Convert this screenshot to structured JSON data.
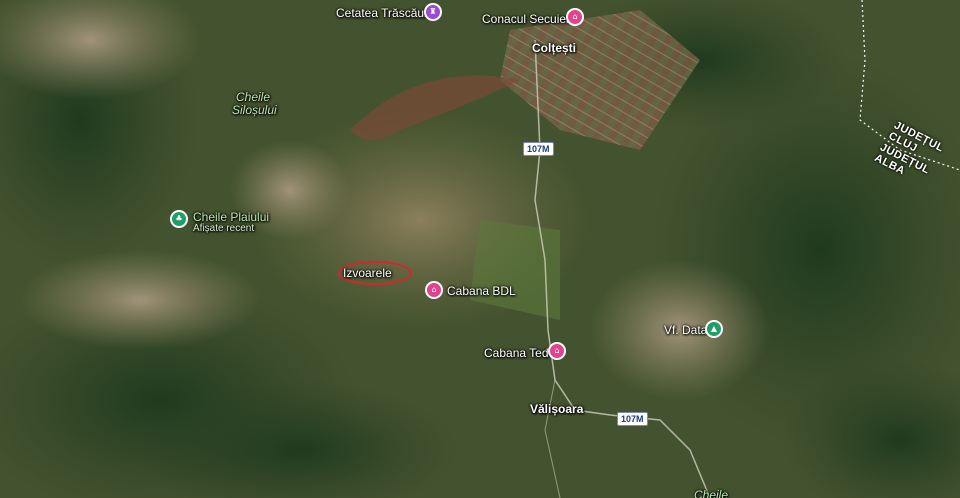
{
  "map": {
    "places": {
      "cetatea": "Cetatea Trăscăului",
      "conacul": "Conacul Secuiesc",
      "coltesti": "Colțești",
      "cheile_silosului_1": "Cheile",
      "cheile_silosului_2": "Siloșului",
      "cheile_plaiului": "Cheile Plaiului",
      "afisate_recent": "Afișate recent",
      "izvoarele": "Izvoarele",
      "cabana_bdl": "Cabana BDL",
      "cabana_teds": "Cabana Ted's",
      "vf_data": "Vf. Data",
      "valisoara": "Vălișoara",
      "cheile_bottom": "Cheile"
    },
    "roads": {
      "road_top": "107M",
      "road_bottom": "107M"
    },
    "counties": {
      "cluj": "JUDEȚUL CLUJ",
      "alba": "JUDEȚUL ALBA"
    },
    "icons": {
      "castle": "castle-icon",
      "hotel": "hotel-icon",
      "park": "tree-icon",
      "mountain": "mountain-icon"
    },
    "colors": {
      "hotel_pin": "#e2428f",
      "castle_pin": "#9a4bd1",
      "park_pin": "#1f9e66",
      "highlight_ellipse": "#d9252a"
    }
  }
}
